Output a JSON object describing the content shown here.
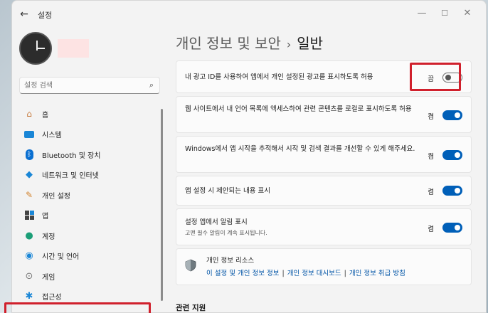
{
  "window": {
    "title": "설정",
    "back_icon": "back-arrow-icon",
    "controls": [
      "minimize-icon",
      "maximize-icon",
      "close-icon"
    ]
  },
  "sidebar": {
    "search": {
      "placeholder": "설정 검색",
      "value": "설정 검색"
    },
    "items": [
      {
        "label": "홈",
        "icon": "home-icon"
      },
      {
        "label": "시스템",
        "icon": "system-icon"
      },
      {
        "label": "Bluetooth 및 장치",
        "icon": "bluetooth-icon"
      },
      {
        "label": "네트워크 및 인터넷",
        "icon": "network-icon"
      },
      {
        "label": "개인 설정",
        "icon": "brush-icon"
      },
      {
        "label": "앱",
        "icon": "apps-icon"
      },
      {
        "label": "계정",
        "icon": "account-icon"
      },
      {
        "label": "시간 및 언어",
        "icon": "globe-clock-icon"
      },
      {
        "label": "게임",
        "icon": "gamepad-icon"
      },
      {
        "label": "접근성",
        "icon": "accessibility-icon"
      }
    ]
  },
  "main": {
    "breadcrumb_parent": "개인 정보 및 보안",
    "breadcrumb_separator": "›",
    "page_title": "일반",
    "settings": [
      {
        "label": "내 광고 ID를 사용하여 앱에서 개인 설정된 광고를 표시하도록 허용",
        "state": "끔",
        "on": false
      },
      {
        "label": "웹 사이트에서 내 언어 목록에 액세스하여 관련 콘텐츠를 로컬로 표시하도록 허용",
        "state": "켬",
        "on": true
      },
      {
        "label": "Windows에서 앱 시작을 추적해서 시작 및 검색 결과를 개선할 수 있게 해주세요.",
        "state": "켬",
        "on": true
      },
      {
        "label": "앱 설정 시 제안되는 내용 표시",
        "state": "켬",
        "on": true
      },
      {
        "label": "설정 앱에서 알림 표시",
        "sublabel": "고맨 필수 알림이 계속 표시됩니다.",
        "state": "켬",
        "on": true
      }
    ],
    "resources": {
      "title": "개인 정보 리소스",
      "links": [
        "이 설정 및 개인 정보 정보",
        "개인 정보 대시보드",
        "개인 정보 취급 방침"
      ],
      "link_separator": "|"
    },
    "related_title": "관련 지원"
  },
  "colors": {
    "accent": "#005fb8",
    "highlight": "#d0202c"
  }
}
